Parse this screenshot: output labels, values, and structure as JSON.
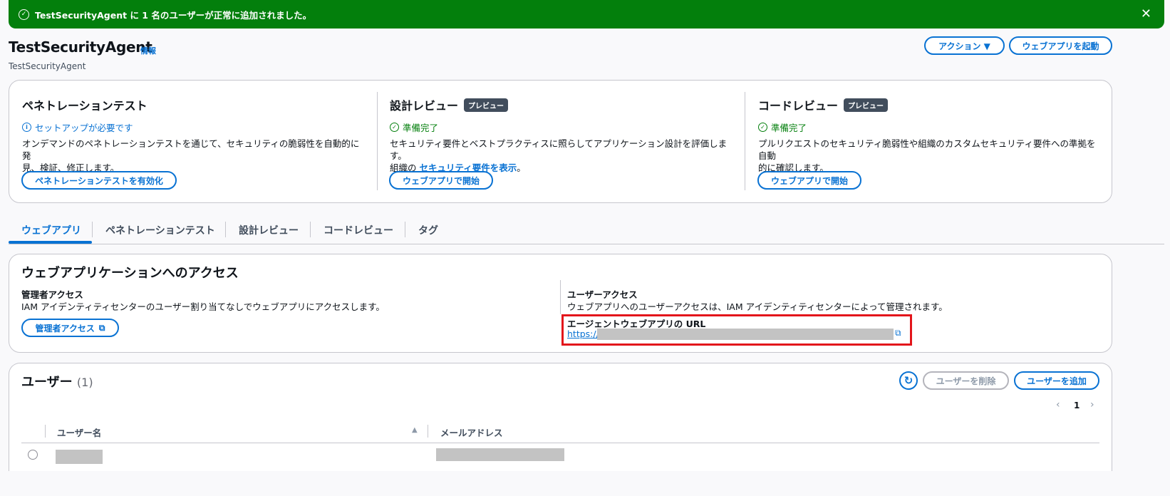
{
  "flash": {
    "message": "TestSecurityAgent に 1 名のユーザーが正常に追加されました。",
    "icon": "check-circle-icon",
    "close_icon": "close-icon",
    "color": "#037f0c"
  },
  "header": {
    "title": "TestSecurityAgent",
    "info_link": "情報",
    "subtitle": "TestSecurityAgent",
    "actions_label": "アクション ▼",
    "launch_label": "ウェブアプリを起動"
  },
  "overview": {
    "pentest": {
      "title": "ペネトレーションテスト",
      "status": "セットアップが必要です",
      "status_icon": "info-icon",
      "desc_line1": "オンデマンドのペネトレーションテストを通じて、セキュリティの脆弱性を自動的に発",
      "desc_line2": "見、検証、修正します。",
      "button": "ペネトレーションテストを有効化"
    },
    "design": {
      "title": "設計レビュー",
      "badge": "プレビュー",
      "status": "準備完了",
      "status_icon": "check-circle-icon",
      "desc_line1": "セキュリティ要件とベストプラクティスに照らしてアプリケーション設計を評価します。",
      "desc_line2_prefix": "組織の ",
      "desc_line2_link": "セキュリティ要件を表示",
      "desc_line2_suffix": "。",
      "button": "ウェブアプリで開始"
    },
    "code": {
      "title": "コードレビュー",
      "badge": "プレビュー",
      "status": "準備完了",
      "status_icon": "check-circle-icon",
      "desc_line1": "プルリクエストのセキュリティ脆弱性や組織のカスタムセキュリティ要件への準拠を自動",
      "desc_line2": "的に確認します。",
      "button": "ウェブアプリで開始"
    }
  },
  "tabs": [
    "ウェブアプリ",
    "ペネトレーションテスト",
    "設計レビュー",
    "コードレビュー",
    "タグ"
  ],
  "access": {
    "title": "ウェブアプリケーションへのアクセス",
    "admin_label": "管理者アクセス",
    "admin_desc": "IAM アイデンティティセンターのユーザー割り当てなしでウェブアプリにアクセスします。",
    "admin_button": "管理者アクセス",
    "user_label": "ユーザーアクセス",
    "user_desc": "ウェブアプリへのユーザーアクセスは、IAM アイデンティティセンターによって管理されます。",
    "url_label": "エージェントウェブアプリの URL",
    "url_prefix": "https://",
    "external_icon": "external-link-icon"
  },
  "users": {
    "title": "ユーザー",
    "count": "(1)",
    "refresh_icon": "refresh-icon",
    "delete_label": "ユーザーを削除",
    "add_label": "ユーザーを追加",
    "page": "1",
    "col_username": "ユーザー名",
    "col_email": "メールアドレス",
    "sort_icon": "sort-up-icon"
  }
}
